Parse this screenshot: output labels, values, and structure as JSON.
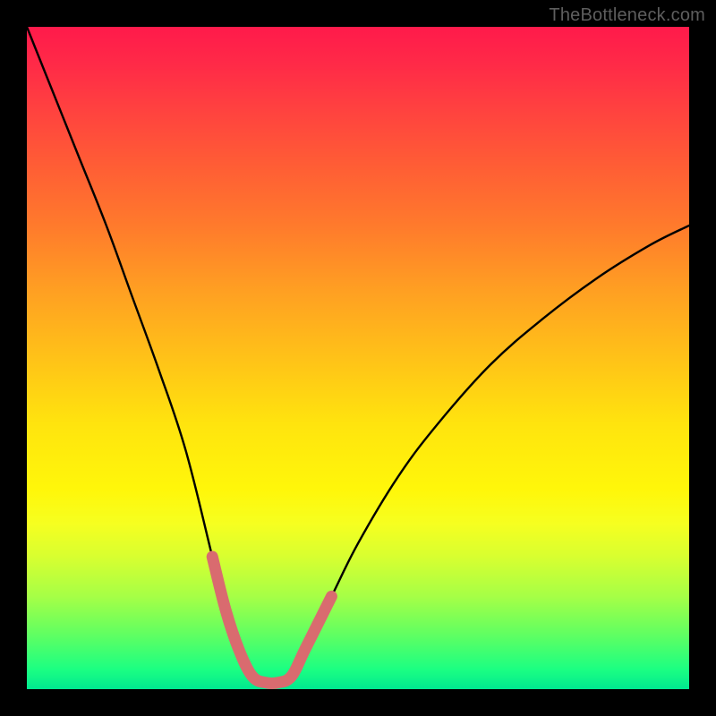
{
  "watermark": "TheBottleneck.com",
  "colors": {
    "background_frame": "#000000",
    "curve": "#000000",
    "highlight": "#d96b6f",
    "gradient_top": "#ff1a4b",
    "gradient_mid": "#ffe40e",
    "gradient_bottom": "#00e890"
  },
  "chart_data": {
    "type": "line",
    "title": "",
    "xlabel": "",
    "ylabel": "",
    "xlim": [
      0,
      100
    ],
    "ylim": [
      0,
      100
    ],
    "note": "No axis ticks or labels are rendered in the image; y increases upward. Values are estimated from pixel positions.",
    "highlight_x_range": [
      30,
      42
    ],
    "series": [
      {
        "name": "bottleneck-curve",
        "x": [
          0,
          4,
          8,
          12,
          16,
          20,
          24,
          28,
          30,
          32,
          34,
          36,
          38,
          40,
          42,
          46,
          50,
          56,
          62,
          70,
          78,
          86,
          94,
          100
        ],
        "y": [
          100,
          90,
          80,
          70,
          59,
          48,
          36,
          20,
          12,
          6,
          2,
          1,
          1,
          2,
          6,
          14,
          22,
          32,
          40,
          49,
          56,
          62,
          67,
          70
        ]
      }
    ]
  }
}
